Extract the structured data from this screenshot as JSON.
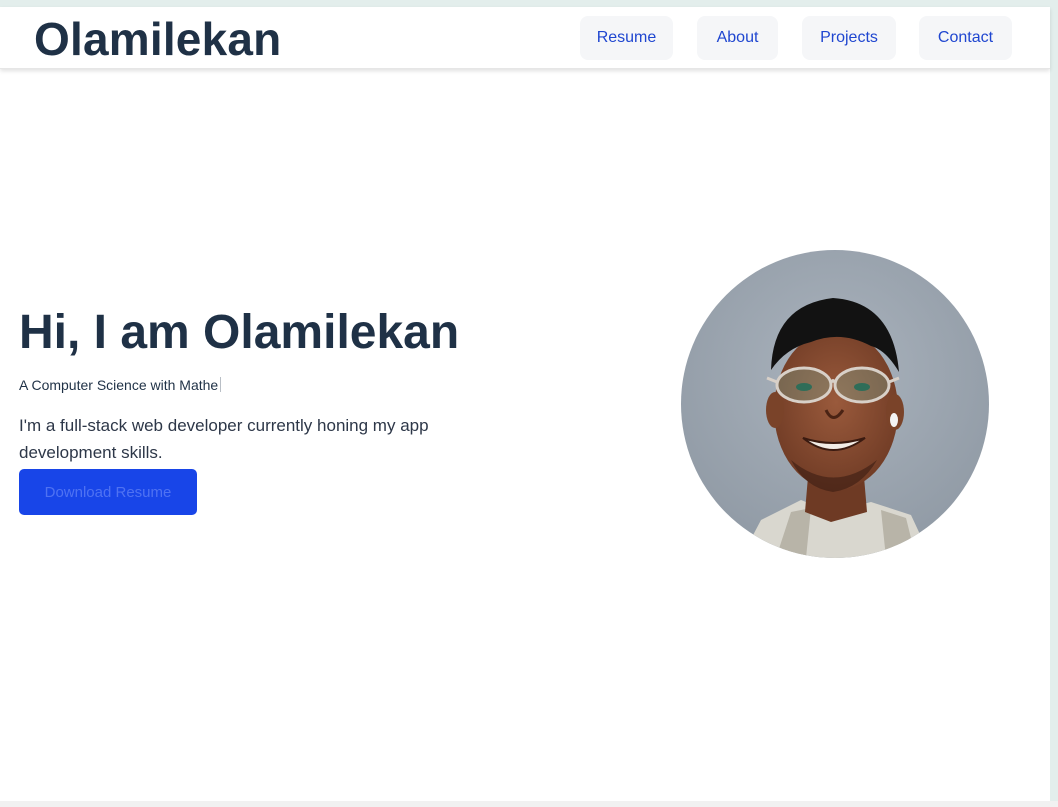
{
  "header": {
    "brand": "Olamilekan",
    "nav": [
      {
        "label": "Resume"
      },
      {
        "label": "About"
      },
      {
        "label": "Projects"
      },
      {
        "label": "Contact"
      }
    ]
  },
  "hero": {
    "title": "Hi, I am Olamilekan",
    "subtitle": "A Computer Science with Mathe",
    "description": "I'm a full-stack web developer currently honing my app development skills.",
    "download_label": "Download Resume"
  },
  "colors": {
    "brand_text": "#1f3146",
    "nav_text": "#1f46d0",
    "nav_bg": "#f5f6f8",
    "button_bg": "#1845e8",
    "button_text": "#4f72f2"
  },
  "avatar": {
    "icon": "profile-photo"
  }
}
